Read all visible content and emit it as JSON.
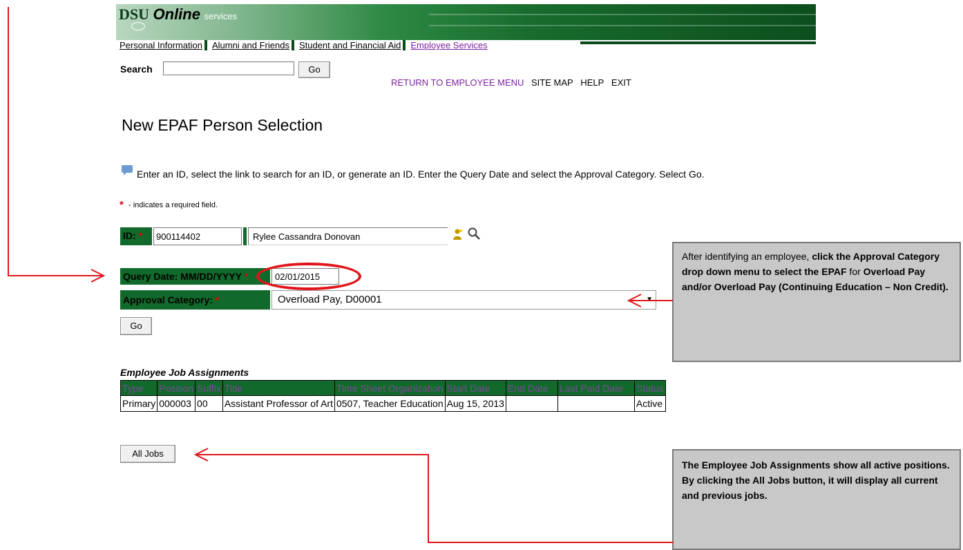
{
  "header": {
    "logo_dsu": "DSU",
    "logo_online": "Online",
    "logo_services": "services"
  },
  "nav": {
    "tabs": [
      {
        "label": "Personal Information"
      },
      {
        "label": "Alumni and Friends"
      },
      {
        "label": "Student and Financial Aid"
      },
      {
        "label": "Employee Services"
      }
    ]
  },
  "search": {
    "label": "Search",
    "value": "",
    "go_label": "Go"
  },
  "top_menu": {
    "return": "RETURN TO EMPLOYEE MENU",
    "site_map": "SITE MAP",
    "help": "HELP",
    "exit": "EXIT"
  },
  "page": {
    "title": "New EPAF Person Selection",
    "instructions": "Enter an ID, select the link to search for an ID, or generate an ID. Enter the Query Date and select the Approval Category. Select Go.",
    "required_star": "*",
    "required_note": " - indicates a required field."
  },
  "form": {
    "id_label": "ID:",
    "id_value": "900114402",
    "name_value": "Rylee Cassandra Donovan",
    "query_date_label": "Query Date: MM/DD/YYYY",
    "query_date_value": "02/01/2015",
    "approval_category_label": "Approval Category:",
    "approval_category_value": "Overload Pay, D00001",
    "go_label": "Go",
    "req_star": "*"
  },
  "jobs": {
    "title": "Employee Job Assignments",
    "headers": [
      "Type",
      "Position",
      "Suffix",
      "Title",
      "Time Sheet Organization",
      "Start Date",
      "End Date",
      "Last Paid Date",
      "Status"
    ],
    "rows": [
      [
        "Primary",
        "000003",
        "00",
        "Assistant Professor of Art",
        "0507, Teacher Education",
        "Aug 15, 2013",
        "",
        "",
        "Active"
      ]
    ],
    "all_jobs_label": "All Jobs"
  },
  "annotations": {
    "callout1_plain1": "After identifying an employee, ",
    "callout1_bold1": "click the Approval Category drop down menu to select the EPAF",
    "callout1_plain2": " for ",
    "callout1_bold2": "Overload Pay and/or Overload Pay (Continuing Education – Non Credit).",
    "callout2": "The Employee Job Assignments show all active positions. By clicking the All Jobs button, it will display all current and previous jobs."
  },
  "colors": {
    "banner_green": "#116a2b",
    "link_purple": "#7b1fa2",
    "annotation_red": "#e0151b",
    "callout_gray": "#c8c8c8"
  }
}
